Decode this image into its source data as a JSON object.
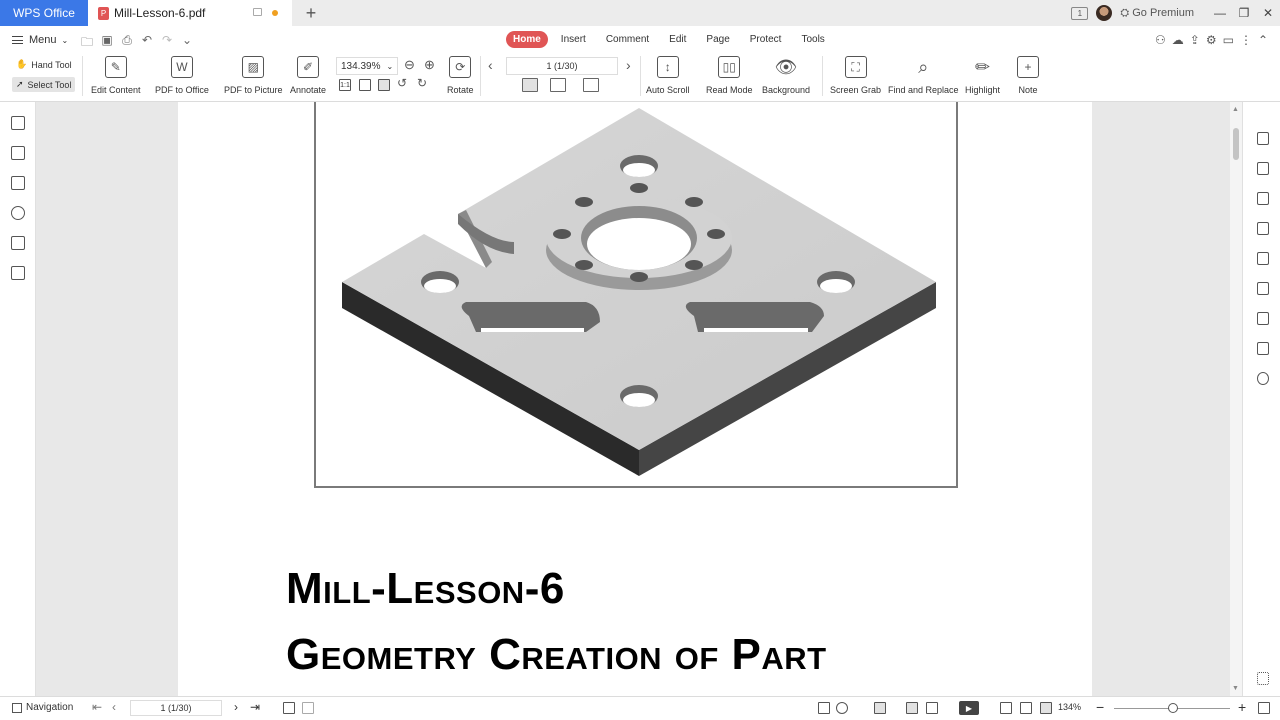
{
  "titlebar": {
    "app_tab": "WPS Office",
    "doc_tab": "Mill-Lesson-6.pdf",
    "new_tab": "+",
    "notification_count": "1",
    "premium": "Go Premium"
  },
  "ribbon": {
    "menu_label": "Menu",
    "tabs": [
      "Home",
      "Insert",
      "Comment",
      "Edit",
      "Page",
      "Protect",
      "Tools"
    ],
    "hand_tool": "Hand Tool",
    "select_tool": "Select Tool",
    "tools": {
      "edit_content": "Edit Content",
      "pdf_to_office": "PDF to Office",
      "pdf_to_picture": "PDF to Picture",
      "annotate": "Annotate",
      "rotate": "Rotate",
      "auto_scroll": "Auto Scroll",
      "read_mode": "Read Mode",
      "background": "Background",
      "screen_grab": "Screen Grab",
      "find_replace": "Find and Replace",
      "highlight": "Highlight",
      "note": "Note"
    },
    "zoom_value": "134.39%",
    "page_indicator": "1 (1/30)"
  },
  "document": {
    "title_line1": "Mill-Lesson-6",
    "title_line2": "Geometry Creation of Part"
  },
  "statusbar": {
    "navigation": "Navigation",
    "page_indicator": "1 (1/30)",
    "zoom": "134%"
  }
}
